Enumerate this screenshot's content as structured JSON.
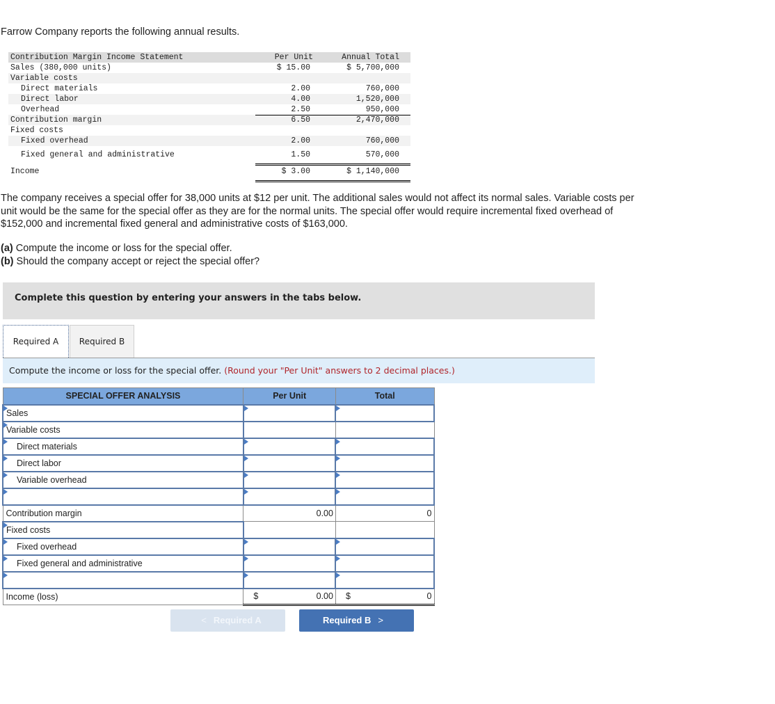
{
  "intro": "Farrow Company reports the following annual results.",
  "statement": {
    "header": {
      "label": "Contribution Margin Income Statement",
      "per_unit": "Per Unit",
      "annual_total": "Annual Total"
    },
    "rows": [
      {
        "label": "Sales (380,000 units)",
        "per_unit": "$ 15.00",
        "annual_total": "$ 5,700,000",
        "indent": false
      },
      {
        "label": "Variable costs",
        "per_unit": "",
        "annual_total": "",
        "indent": false
      },
      {
        "label": "Direct materials",
        "per_unit": "2.00",
        "annual_total": "760,000",
        "indent": true
      },
      {
        "label": "Direct labor",
        "per_unit": "4.00",
        "annual_total": "1,520,000",
        "indent": true
      },
      {
        "label": "Overhead",
        "per_unit": "2.50",
        "annual_total": "950,000",
        "indent": true
      },
      {
        "label": "Contribution margin",
        "per_unit": "6.50",
        "annual_total": "2,470,000",
        "indent": false
      },
      {
        "label": "Fixed costs",
        "per_unit": "",
        "annual_total": "",
        "indent": false
      },
      {
        "label": "Fixed overhead",
        "per_unit": "2.00",
        "annual_total": "760,000",
        "indent": true
      },
      {
        "label": "Fixed general and administrative",
        "per_unit": "1.50",
        "annual_total": "570,000",
        "indent": true
      },
      {
        "label": "Income",
        "per_unit": "$ 3.00",
        "annual_total": "$ 1,140,000",
        "indent": false
      }
    ]
  },
  "paragraph": "The company receives a special offer for 38,000 units at $12 per unit. The additional sales would not affect its normal sales. Variable costs per unit would be the same for the special offer as they are for the normal units. The special offer would require incremental fixed overhead of $152,000 and incremental fixed general and administrative costs of $163,000.",
  "questions": [
    {
      "tag": "(a)",
      "text": " Compute the income or loss for the special offer."
    },
    {
      "tag": "(b)",
      "text": " Should the company accept or reject the special offer?"
    }
  ],
  "banner": "Complete this question by entering your answers in the tabs below.",
  "tabs": [
    {
      "label": "Required A",
      "active": true
    },
    {
      "label": "Required B",
      "active": false
    }
  ],
  "instruction": {
    "text": "Compute the income or loss for the special offer.",
    "note": "(Round your \"Per Unit\" answers to 2 decimal places.)"
  },
  "analysis": {
    "headers": [
      "SPECIAL OFFER ANALYSIS",
      "Per Unit",
      "Total"
    ],
    "rows": [
      {
        "label": "Sales",
        "per_unit": "",
        "total": "",
        "indent": false
      },
      {
        "label": "Variable costs",
        "per_unit": "",
        "total": "",
        "indent": false
      },
      {
        "label": "Direct materials",
        "per_unit": "",
        "total": "",
        "indent": true
      },
      {
        "label": "Direct labor",
        "per_unit": "",
        "total": "",
        "indent": true
      },
      {
        "label": "Variable overhead",
        "per_unit": "",
        "total": "",
        "indent": true
      },
      {
        "label": "",
        "per_unit": "",
        "total": "",
        "indent": false
      },
      {
        "label": "Contribution margin",
        "per_unit": "0.00",
        "total": "0",
        "indent": false
      },
      {
        "label": "Fixed costs",
        "per_unit": "",
        "total": "",
        "indent": false
      },
      {
        "label": "Fixed overhead",
        "per_unit": "",
        "total": "",
        "indent": true
      },
      {
        "label": "Fixed general and administrative",
        "per_unit": "",
        "total": "",
        "indent": true
      },
      {
        "label": "",
        "per_unit": "",
        "total": "",
        "indent": false
      },
      {
        "label": "Income (loss)",
        "per_unit": "0.00",
        "total": "0",
        "currency": "$",
        "indent": false
      }
    ]
  },
  "nav": {
    "prev_label": "Required A",
    "next_label": "Required B",
    "prev_icon": "chevron-left-icon",
    "next_icon": "chevron-right-icon",
    "prev_glyph": "<",
    "next_glyph": ">"
  }
}
